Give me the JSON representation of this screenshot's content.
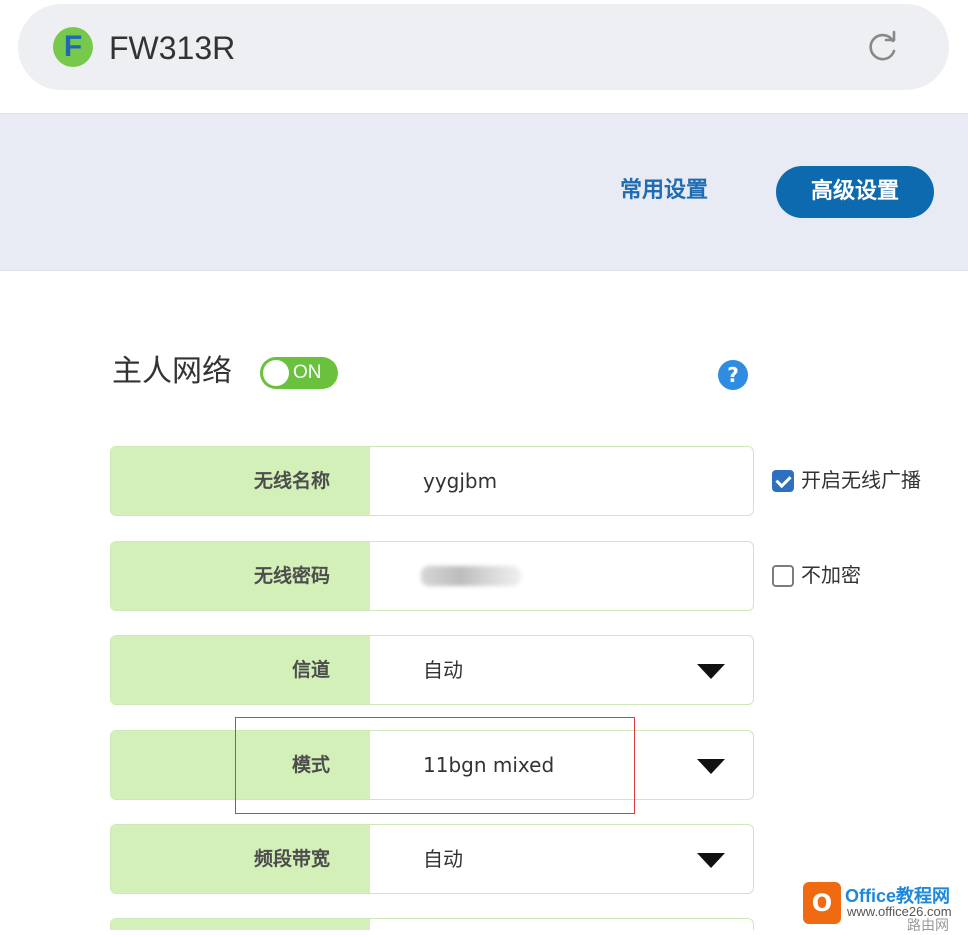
{
  "browser": {
    "logo_letter": "F",
    "title": "FW313R",
    "reload_icon": "reload-icon"
  },
  "nav": {
    "basic_settings": "常用设置",
    "advanced_settings": "高级设置"
  },
  "section": {
    "title": "主人网络",
    "toggle_state": "ON",
    "help_icon": "question-icon",
    "help_glyph": "?"
  },
  "form": {
    "ssid": {
      "label": "无线名称",
      "value": "yygjbm"
    },
    "password": {
      "label": "无线密码"
    },
    "channel": {
      "label": "信道",
      "value": "自动"
    },
    "mode": {
      "label": "模式",
      "value": "11bgn mixed"
    },
    "bandwidth": {
      "label": "频段带宽",
      "value": "自动"
    }
  },
  "options": {
    "broadcast": {
      "label": "开启无线广播",
      "checked": true
    },
    "no_encryption": {
      "label": "不加密",
      "checked": false
    }
  },
  "watermark": {
    "brand": "Office教程网",
    "url": "www.office26.com",
    "source": "路由网"
  },
  "colors": {
    "accent_blue": "#0e6aaf",
    "toggle_green": "#6ac13e",
    "label_green": "#d2f0b8",
    "highlight_red": "#e2393a"
  }
}
